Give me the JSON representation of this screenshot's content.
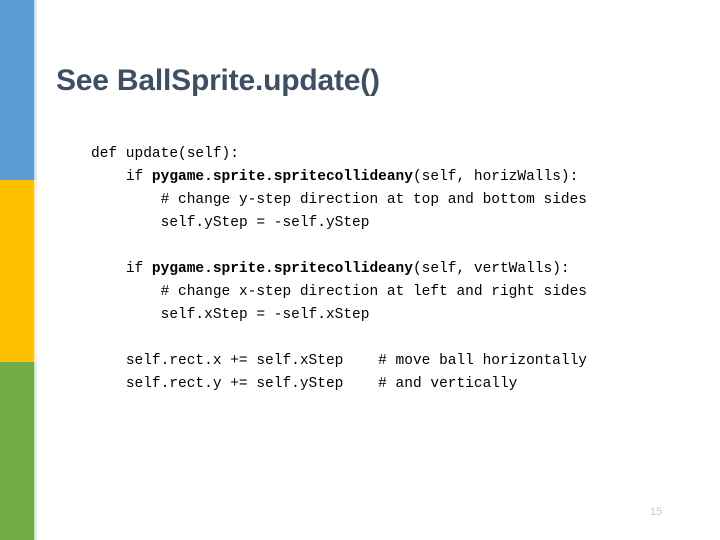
{
  "slide": {
    "title": "See BallSprite.update()",
    "page_number": "15",
    "background_color": "#ffffff",
    "title_color": "#3E4F63",
    "page_number_color": "#c8c8c8"
  },
  "rail": {
    "segments": [
      {
        "name": "blue",
        "color": "#5B9BD5"
      },
      {
        "name": "yellow",
        "color": "#FFC000"
      },
      {
        "name": "green",
        "color": "#70AD47"
      }
    ]
  },
  "code": {
    "language": "python",
    "lines": [
      {
        "indent": 0,
        "segments": [
          {
            "text": "def update(self):",
            "bold": false
          }
        ]
      },
      {
        "indent": 1,
        "segments": [
          {
            "text": "if ",
            "bold": false
          },
          {
            "text": "pygame.sprite.spritecollideany",
            "bold": true
          },
          {
            "text": "(self, horizWalls):",
            "bold": false
          }
        ]
      },
      {
        "indent": 2,
        "segments": [
          {
            "text": "# change y-step direction at top and bottom sides",
            "bold": false
          }
        ]
      },
      {
        "indent": 2,
        "segments": [
          {
            "text": "self.yStep = -self.yStep",
            "bold": false
          }
        ]
      },
      {
        "indent": 0,
        "segments": []
      },
      {
        "indent": 1,
        "segments": [
          {
            "text": "if ",
            "bold": false
          },
          {
            "text": "pygame.sprite.spritecollideany",
            "bold": true
          },
          {
            "text": "(self, vertWalls):",
            "bold": false
          }
        ]
      },
      {
        "indent": 2,
        "segments": [
          {
            "text": "# change x-step direction at left and right sides",
            "bold": false
          }
        ]
      },
      {
        "indent": 2,
        "segments": [
          {
            "text": "self.xStep = -self.xStep",
            "bold": false
          }
        ]
      },
      {
        "indent": 0,
        "segments": []
      },
      {
        "indent": 1,
        "segments": [
          {
            "text": "self.rect.x += self.xStep    # move ball horizontally",
            "bold": false
          }
        ]
      },
      {
        "indent": 1,
        "segments": [
          {
            "text": "self.rect.y += self.yStep    # and vertically",
            "bold": false
          }
        ]
      }
    ]
  }
}
